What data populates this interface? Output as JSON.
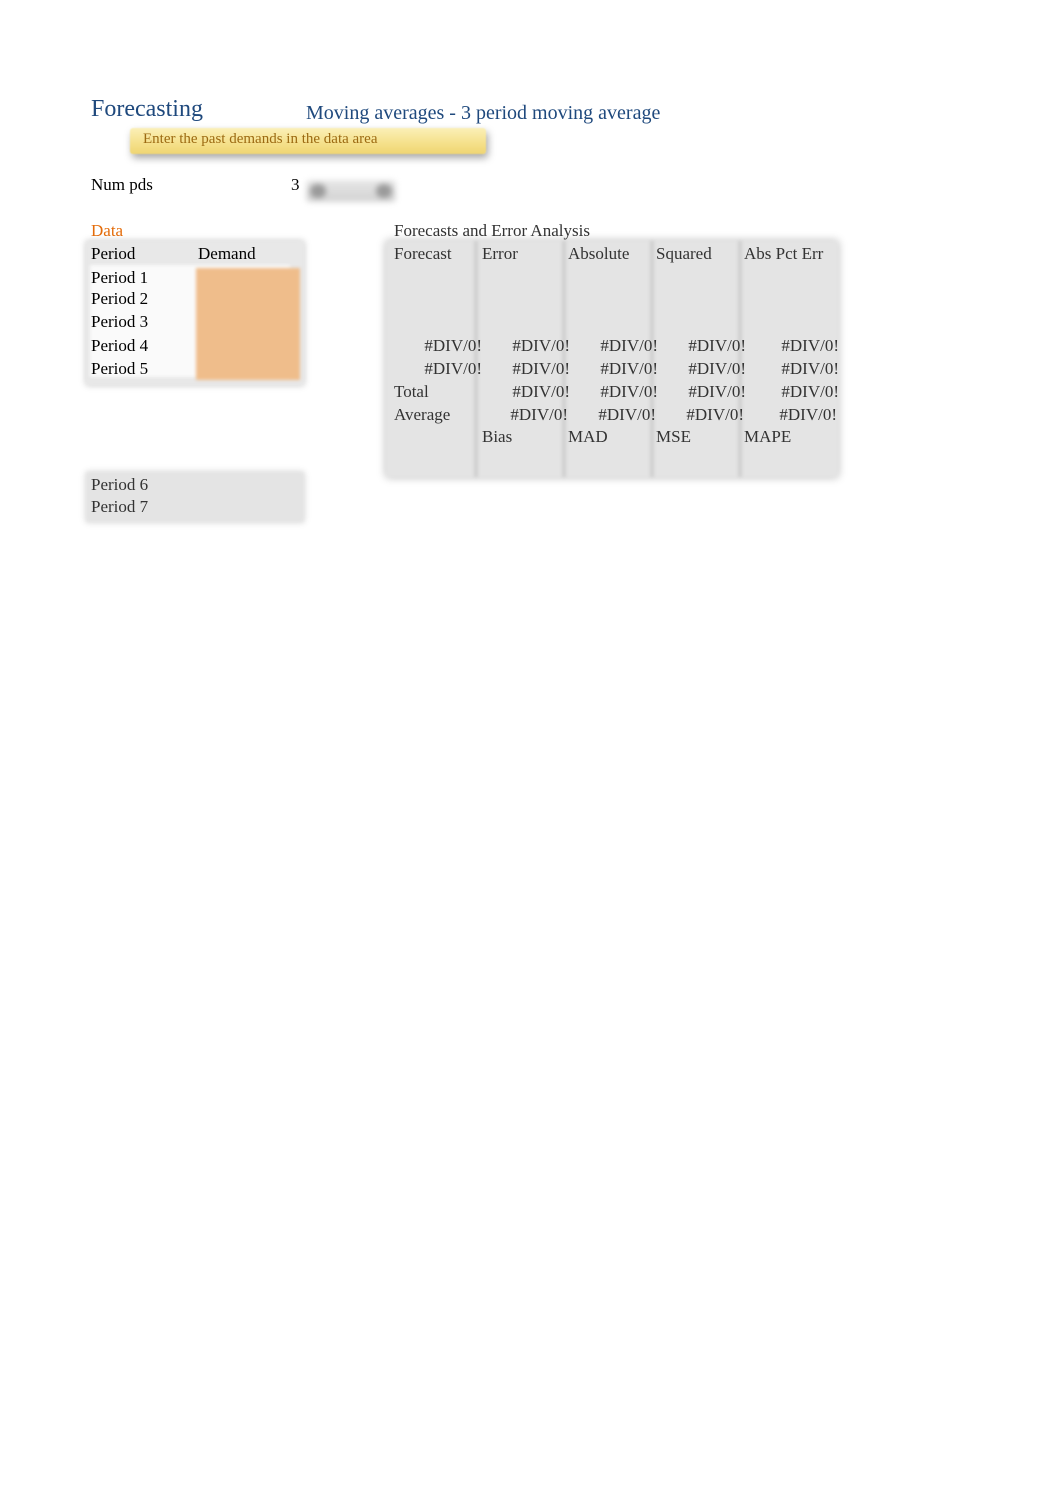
{
  "header": {
    "title": "Forecasting",
    "subtitle": "Moving averages -  3 period moving average",
    "instruction": "Enter the past demands in the data area"
  },
  "num_periods": {
    "label": "Num pds",
    "value": "3"
  },
  "data_section": {
    "label": "Data",
    "col_period": "Period",
    "col_demand": "Demand",
    "rows": [
      {
        "period": "Period 1",
        "demand": ""
      },
      {
        "period": "Period 2",
        "demand": ""
      },
      {
        "period": "Period 3",
        "demand": ""
      },
      {
        "period": "Period 4",
        "demand": ""
      },
      {
        "period": "Period 5",
        "demand": ""
      }
    ]
  },
  "forecast_section": {
    "title": "Forecasts and Error Analysis",
    "columns": [
      "Forecast",
      "Error",
      "Absolute",
      "Squared",
      "Abs Pct Err"
    ],
    "rows": [
      [
        "",
        "",
        "",
        "",
        ""
      ],
      [
        "",
        "",
        "",
        "",
        ""
      ],
      [
        "",
        "",
        "",
        "",
        ""
      ],
      [
        "#DIV/0!",
        "#DIV/0!",
        "#DIV/0!",
        "#DIV/0!",
        "#DIV/0!"
      ],
      [
        "#DIV/0!",
        "#DIV/0!",
        "#DIV/0!",
        "#DIV/0!",
        "#DIV/0!"
      ]
    ],
    "total": {
      "label": "Total",
      "values": [
        "#DIV/0!",
        "#DIV/0!",
        "#DIV/0!",
        "#DIV/0!"
      ]
    },
    "average": {
      "label": "Average",
      "values": [
        "#DIV/0!",
        "#DIV/0!",
        "#DIV/0!",
        "#DIV/0!"
      ]
    },
    "summary_labels": [
      "Bias",
      "MAD",
      "MSE",
      "MAPE"
    ]
  },
  "predictions": {
    "rows": [
      {
        "period": "Period 6",
        "value": ""
      },
      {
        "period": "Period 7",
        "value": ""
      }
    ]
  },
  "colors": {
    "title": "#1f497d",
    "data_label": "#e46c0a",
    "demand_input": "#efbd8b",
    "instruction_bg": "#f5e08a",
    "instruction_text": "#9c6a12"
  }
}
